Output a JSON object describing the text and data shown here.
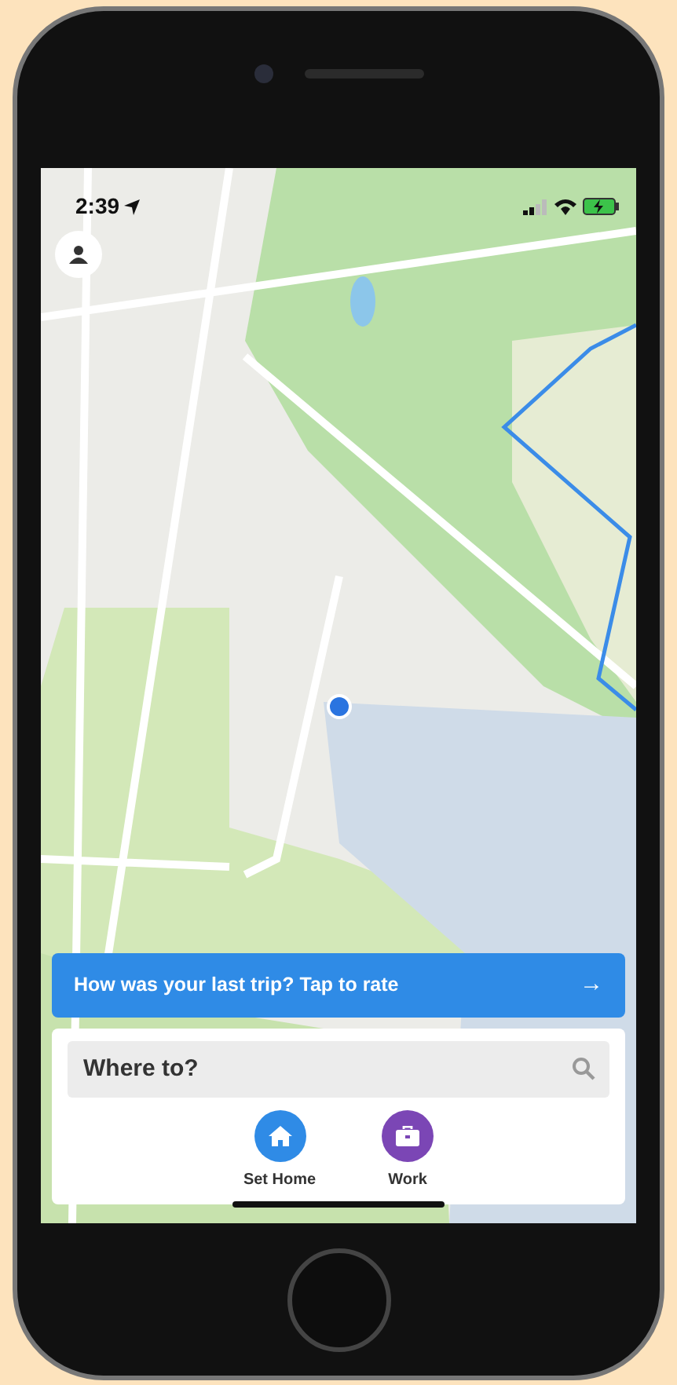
{
  "status_bar": {
    "time": "2:39"
  },
  "rating_banner": {
    "text": "How was your last trip? Tap to rate",
    "arrow": "→"
  },
  "search": {
    "placeholder": "Where to?"
  },
  "shortcuts": [
    {
      "label": "Set Home",
      "kind": "home",
      "color": "#2f8be6"
    },
    {
      "label": "Work",
      "kind": "work",
      "color": "#7b46b5"
    }
  ]
}
